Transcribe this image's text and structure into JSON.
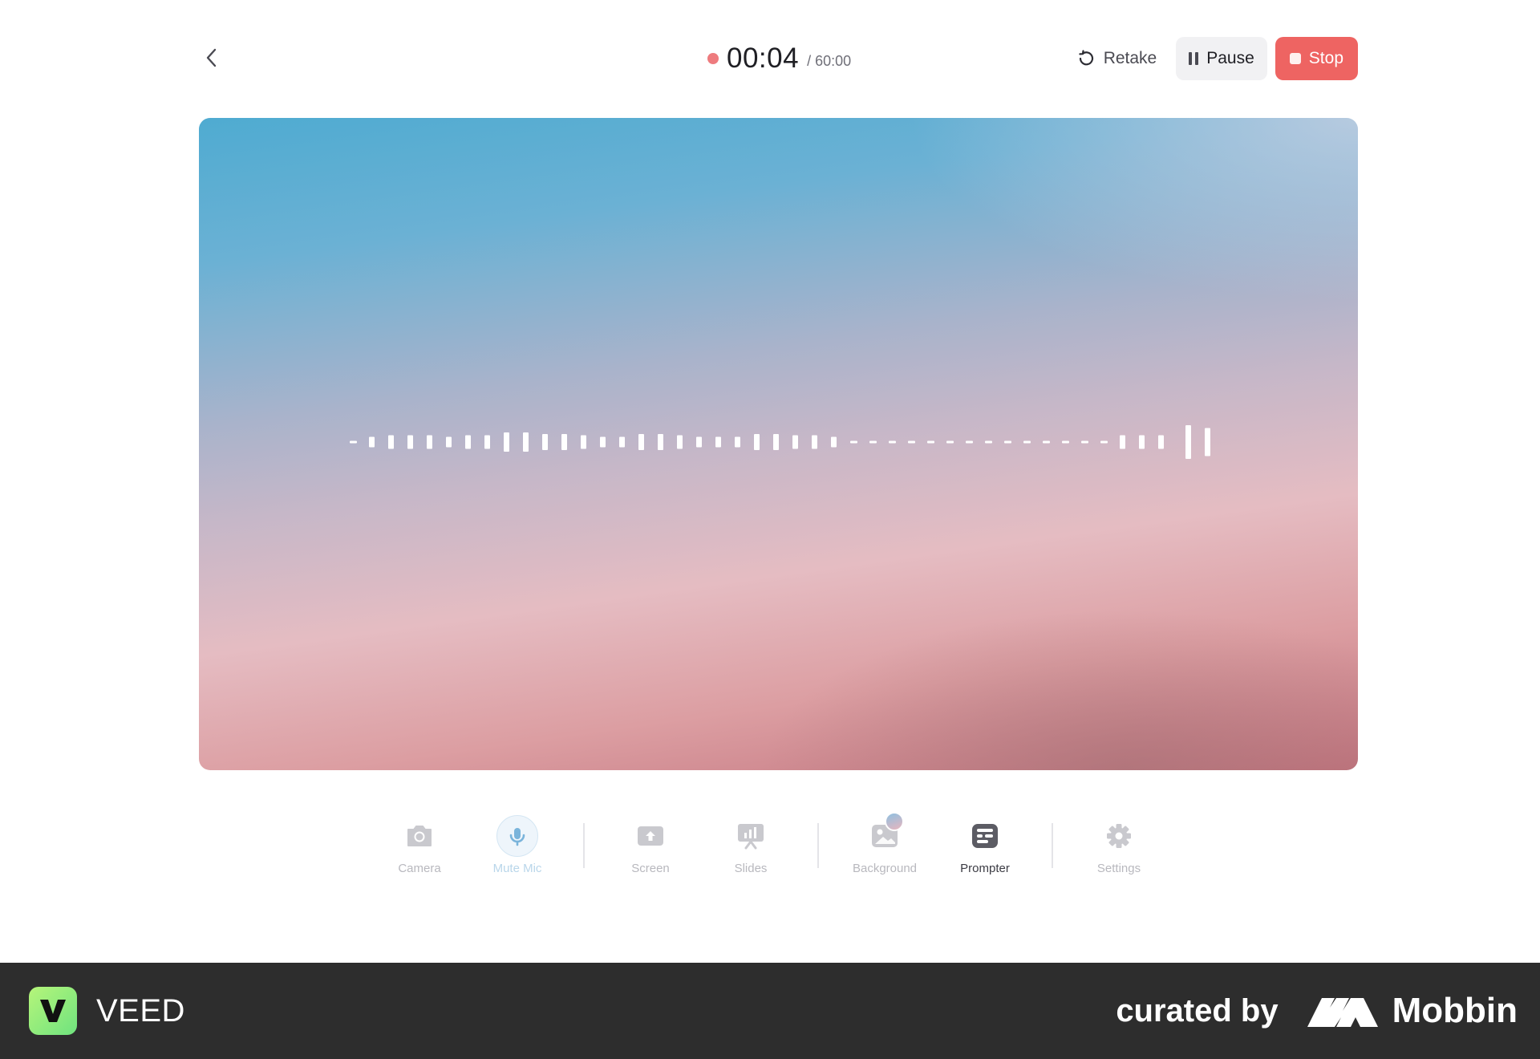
{
  "header": {
    "back_icon": "chevron-left-icon",
    "timer": {
      "elapsed": "00:04",
      "total": "/ 60:00",
      "dot_color": "#ee7b7e"
    },
    "actions": {
      "retake_label": "Retake",
      "retake_icon": "rotate-ccw-icon",
      "pause_label": "Pause",
      "pause_icon": "pause-icon",
      "stop_label": "Stop",
      "stop_icon": "stop-square-icon",
      "stop_color": "#ee6462"
    }
  },
  "preview": {
    "waveform_levels": [
      1,
      2,
      3,
      3,
      3,
      2,
      3,
      3,
      5,
      5,
      4,
      4,
      3,
      2,
      2,
      4,
      4,
      3,
      2,
      2,
      2,
      4,
      4,
      3,
      3,
      2,
      1,
      1,
      1,
      1,
      1,
      1,
      1,
      1,
      1,
      1,
      1,
      1,
      1,
      1,
      3,
      3,
      3,
      10,
      8
    ]
  },
  "toolbar": {
    "items": [
      {
        "label": "Camera",
        "icon": "camera-icon",
        "state": "disabled"
      },
      {
        "label": "Mute Mic",
        "icon": "microphone-icon",
        "state": "selected"
      },
      {
        "label": "Screen",
        "icon": "screen-share-icon",
        "state": "disabled"
      },
      {
        "label": "Slides",
        "icon": "presentation-icon",
        "state": "disabled"
      },
      {
        "label": "Background",
        "icon": "image-icon",
        "state": "disabled"
      },
      {
        "label": "Prompter",
        "icon": "prompter-icon",
        "state": "active"
      },
      {
        "label": "Settings",
        "icon": "gear-icon",
        "state": "disabled"
      }
    ]
  },
  "footer": {
    "brand_name": "VEED",
    "brand_logo_letter": "V",
    "curated_by": "curated by",
    "curator": "Mobbin",
    "brand_color": "#8fef7c"
  }
}
